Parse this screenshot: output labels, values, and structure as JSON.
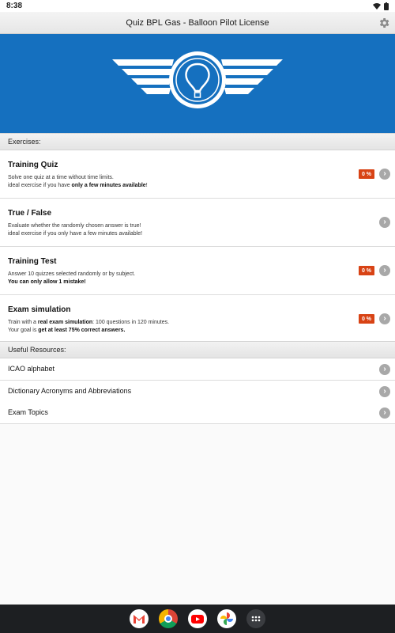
{
  "status_bar": {
    "time": "8:38"
  },
  "app_bar": {
    "title": "Quiz BPL Gas - Balloon Pilot License"
  },
  "sections": {
    "exercises": "Exercises:",
    "resources": "Useful Resources:"
  },
  "exercises": [
    {
      "title": "Training Quiz",
      "line1": "Solve one quiz at a time without time limits.",
      "line2_pre": "ideal exercise if you have ",
      "line2_bold": "only a few minutes available",
      "line2_post": "!",
      "badge": "0 %"
    },
    {
      "title": "True / False",
      "line1": "Evaluate whether the randomly chosen answer is true!",
      "line2": "ideal exercise if you only have a few minutes available!"
    },
    {
      "title": "Training Test",
      "line1": "Answer 10 quizzes selected randomly or by subject.",
      "line2_bold": "You can only allow 1 mistake!",
      "badge": "0 %"
    },
    {
      "title": "Exam simulation",
      "line1_pre": "Train with a ",
      "line1_bold": "real exam simulation",
      "line1_post": ": 100 questions in 120 minutes.",
      "line2_pre": "Your goal is ",
      "line2_bold": "get at least 75% correct answers.",
      "badge": "0 %"
    }
  ],
  "resources": [
    {
      "label": "ICAO alphabet"
    },
    {
      "label": "Dictionary Acronyms and Abbreviations"
    },
    {
      "label": "Exam Topics"
    }
  ],
  "chevron_glyph": "›",
  "icons": {
    "settings": "gear-icon",
    "banner": "balloon-wings-logo"
  },
  "colors": {
    "banner": "#1570bf",
    "badge": "#d84315"
  }
}
